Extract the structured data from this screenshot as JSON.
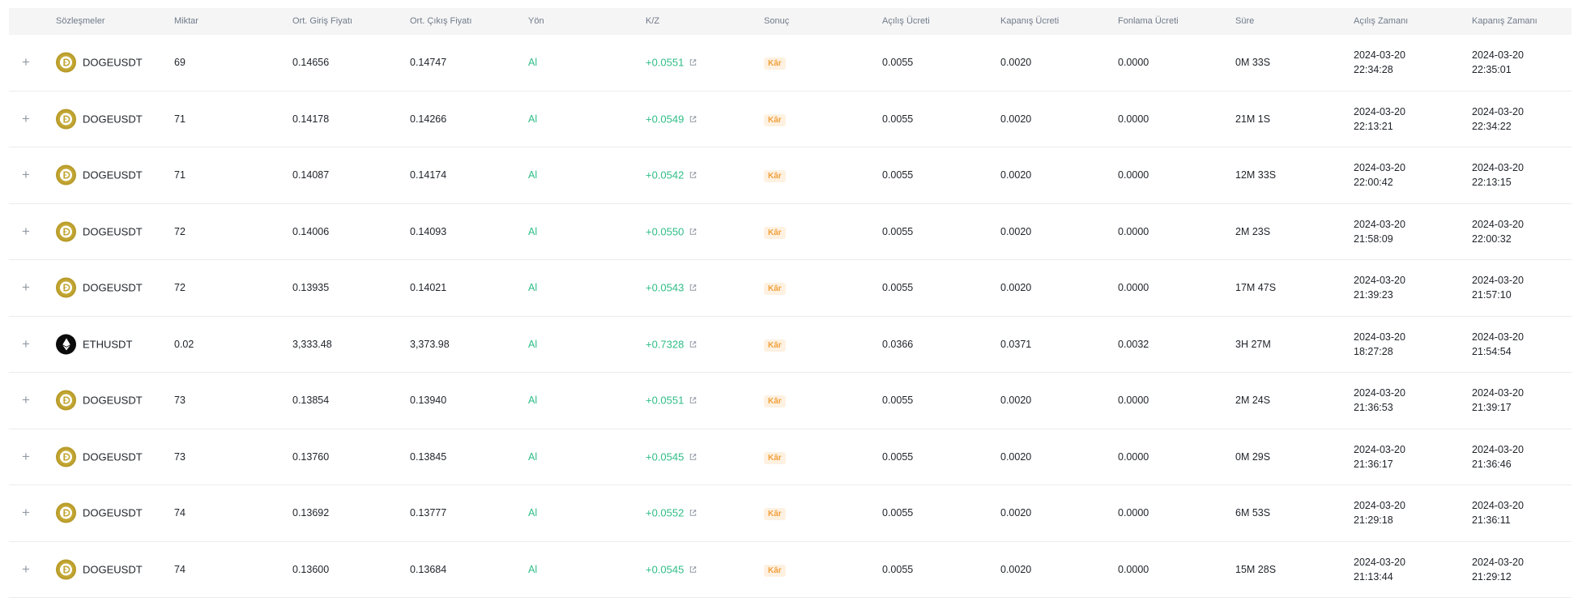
{
  "headers": {
    "contracts": "Sözleşmeler",
    "amount": "Miktar",
    "avg_entry": "Ort. Giriş Fiyatı",
    "avg_exit": "Ort. Çıkış Fiyatı",
    "direction": "Yön",
    "pnl": "K/Z",
    "result": "Sonuç",
    "open_fee": "Açılış Ücreti",
    "close_fee": "Kapanış Ücreti",
    "funding_fee": "Fonlama Ücreti",
    "duration": "Süre",
    "open_time": "Açılış Zamanı",
    "close_time": "Kapanış Zamanı"
  },
  "expand_symbol": "+",
  "colors": {
    "profit_green": "#2ebd85",
    "badge_text": "#f0a03c",
    "badge_bg": "#fef1e1",
    "header_bg": "#f5f5f5",
    "doge_gold": "#c2a633",
    "eth_black": "#0b0b0b"
  },
  "rows": [
    {
      "coin_icon": "doge-coin-icon",
      "symbol": "DOGEUSDT",
      "amount": "69",
      "entry": "0.14656",
      "exit": "0.14747",
      "side": "Al",
      "pnl": "+0.0551",
      "result": "Kâr",
      "open_fee": "0.0055",
      "close_fee": "0.0020",
      "funding_fee": "0.0000",
      "duration": "0M 33S",
      "open_date": "2024-03-20",
      "open_clock": "22:34:28",
      "close_date": "2024-03-20",
      "close_clock": "22:35:01"
    },
    {
      "coin_icon": "doge-coin-icon",
      "symbol": "DOGEUSDT",
      "amount": "71",
      "entry": "0.14178",
      "exit": "0.14266",
      "side": "Al",
      "pnl": "+0.0549",
      "result": "Kâr",
      "open_fee": "0.0055",
      "close_fee": "0.0020",
      "funding_fee": "0.0000",
      "duration": "21M 1S",
      "open_date": "2024-03-20",
      "open_clock": "22:13:21",
      "close_date": "2024-03-20",
      "close_clock": "22:34:22"
    },
    {
      "coin_icon": "doge-coin-icon",
      "symbol": "DOGEUSDT",
      "amount": "71",
      "entry": "0.14087",
      "exit": "0.14174",
      "side": "Al",
      "pnl": "+0.0542",
      "result": "Kâr",
      "open_fee": "0.0055",
      "close_fee": "0.0020",
      "funding_fee": "0.0000",
      "duration": "12M 33S",
      "open_date": "2024-03-20",
      "open_clock": "22:00:42",
      "close_date": "2024-03-20",
      "close_clock": "22:13:15"
    },
    {
      "coin_icon": "doge-coin-icon",
      "symbol": "DOGEUSDT",
      "amount": "72",
      "entry": "0.14006",
      "exit": "0.14093",
      "side": "Al",
      "pnl": "+0.0550",
      "result": "Kâr",
      "open_fee": "0.0055",
      "close_fee": "0.0020",
      "funding_fee": "0.0000",
      "duration": "2M 23S",
      "open_date": "2024-03-20",
      "open_clock": "21:58:09",
      "close_date": "2024-03-20",
      "close_clock": "22:00:32"
    },
    {
      "coin_icon": "doge-coin-icon",
      "symbol": "DOGEUSDT",
      "amount": "72",
      "entry": "0.13935",
      "exit": "0.14021",
      "side": "Al",
      "pnl": "+0.0543",
      "result": "Kâr",
      "open_fee": "0.0055",
      "close_fee": "0.0020",
      "funding_fee": "0.0000",
      "duration": "17M 47S",
      "open_date": "2024-03-20",
      "open_clock": "21:39:23",
      "close_date": "2024-03-20",
      "close_clock": "21:57:10"
    },
    {
      "coin_icon": "eth-coin-icon",
      "symbol": "ETHUSDT",
      "amount": "0.02",
      "entry": "3,333.48",
      "exit": "3,373.98",
      "side": "Al",
      "pnl": "+0.7328",
      "result": "Kâr",
      "open_fee": "0.0366",
      "close_fee": "0.0371",
      "funding_fee": "0.0032",
      "duration": "3H 27M",
      "open_date": "2024-03-20",
      "open_clock": "18:27:28",
      "close_date": "2024-03-20",
      "close_clock": "21:54:54"
    },
    {
      "coin_icon": "doge-coin-icon",
      "symbol": "DOGEUSDT",
      "amount": "73",
      "entry": "0.13854",
      "exit": "0.13940",
      "side": "Al",
      "pnl": "+0.0551",
      "result": "Kâr",
      "open_fee": "0.0055",
      "close_fee": "0.0020",
      "funding_fee": "0.0000",
      "duration": "2M 24S",
      "open_date": "2024-03-20",
      "open_clock": "21:36:53",
      "close_date": "2024-03-20",
      "close_clock": "21:39:17"
    },
    {
      "coin_icon": "doge-coin-icon",
      "symbol": "DOGEUSDT",
      "amount": "73",
      "entry": "0.13760",
      "exit": "0.13845",
      "side": "Al",
      "pnl": "+0.0545",
      "result": "Kâr",
      "open_fee": "0.0055",
      "close_fee": "0.0020",
      "funding_fee": "0.0000",
      "duration": "0M 29S",
      "open_date": "2024-03-20",
      "open_clock": "21:36:17",
      "close_date": "2024-03-20",
      "close_clock": "21:36:46"
    },
    {
      "coin_icon": "doge-coin-icon",
      "symbol": "DOGEUSDT",
      "amount": "74",
      "entry": "0.13692",
      "exit": "0.13777",
      "side": "Al",
      "pnl": "+0.0552",
      "result": "Kâr",
      "open_fee": "0.0055",
      "close_fee": "0.0020",
      "funding_fee": "0.0000",
      "duration": "6M 53S",
      "open_date": "2024-03-20",
      "open_clock": "21:29:18",
      "close_date": "2024-03-20",
      "close_clock": "21:36:11"
    },
    {
      "coin_icon": "doge-coin-icon",
      "symbol": "DOGEUSDT",
      "amount": "74",
      "entry": "0.13600",
      "exit": "0.13684",
      "side": "Al",
      "pnl": "+0.0545",
      "result": "Kâr",
      "open_fee": "0.0055",
      "close_fee": "0.0020",
      "funding_fee": "0.0000",
      "duration": "15M 28S",
      "open_date": "2024-03-20",
      "open_clock": "21:13:44",
      "close_date": "2024-03-20",
      "close_clock": "21:29:12"
    }
  ]
}
